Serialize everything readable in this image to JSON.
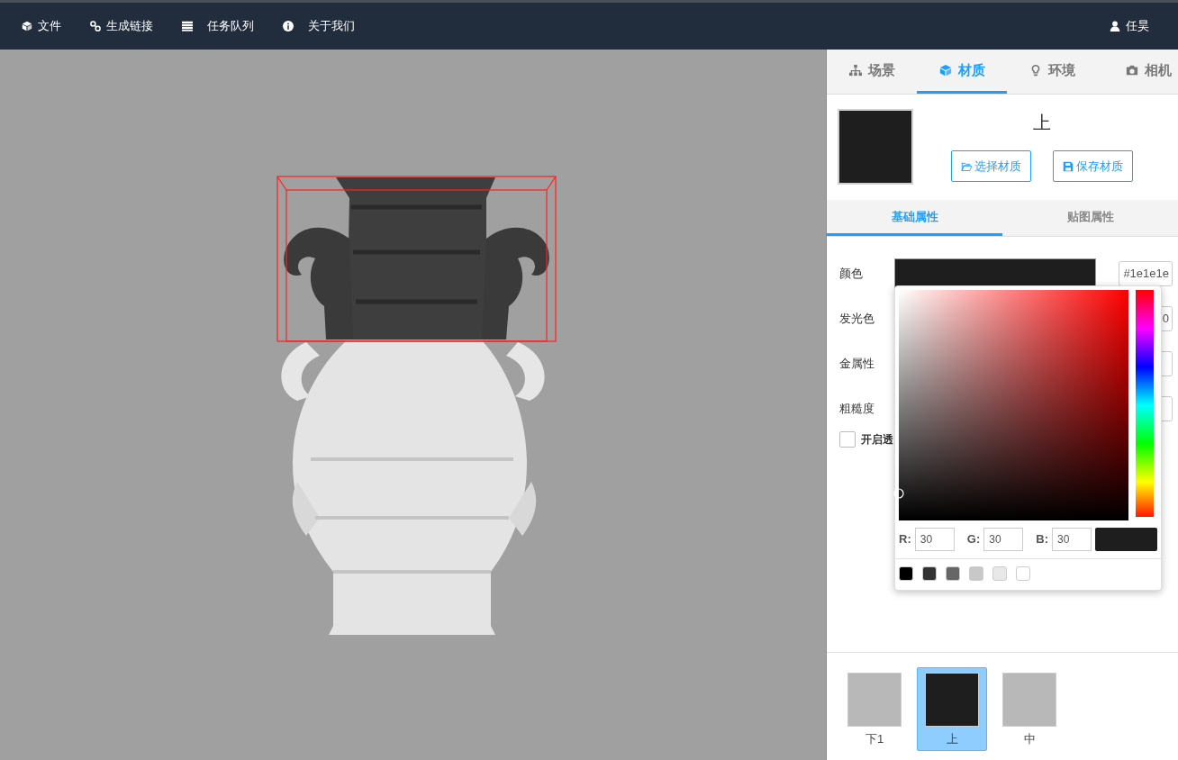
{
  "navbar": {
    "items": [
      {
        "label": "文件"
      },
      {
        "label": "生成链接"
      },
      {
        "label": "任务队列"
      },
      {
        "label": "关于我们"
      }
    ],
    "user": "任昊"
  },
  "panel_tabs": [
    {
      "label": "场景",
      "selected": false
    },
    {
      "label": "材质",
      "selected": true
    },
    {
      "label": "环境",
      "selected": false
    },
    {
      "label": "相机",
      "selected": false
    }
  ],
  "material": {
    "name": "上",
    "color": "#1e1e1e",
    "buttons": [
      "选择材质",
      "保存材质"
    ]
  },
  "sub_tabs": [
    {
      "label": "基础属性",
      "selected": true
    },
    {
      "label": "贴图属性",
      "selected": false
    }
  ],
  "properties": [
    {
      "label": "颜色",
      "kind": "color",
      "color": "#1e1e1e",
      "value": "#1e1e1e"
    },
    {
      "label": "发光色",
      "kind": "text",
      "value": "0"
    },
    {
      "label": "金属性",
      "kind": "text"
    },
    {
      "label": "粗糙度",
      "kind": "text"
    }
  ],
  "transparency": {
    "label": "开启透",
    "checked": false
  },
  "color_picker": {
    "channels": [
      {
        "label": "R:",
        "value": "30"
      },
      {
        "label": "G:",
        "value": "30"
      },
      {
        "label": "B:",
        "value": "30"
      }
    ],
    "hue": {
      "level": 0
    },
    "swatches": [
      {
        "color": "#000000"
      },
      {
        "color": "#333333"
      },
      {
        "color": "#666666"
      },
      {
        "color": "#c8c8c8"
      },
      {
        "color": "#e8e8e8"
      },
      {
        "color": "#ffffff"
      }
    ]
  },
  "materials": [
    {
      "label": "下1",
      "color": "#b8b8b8",
      "selected": false
    },
    {
      "label": "上",
      "color": "#1e1e1e",
      "selected": true
    },
    {
      "label": "中",
      "color": "#b8b8b8",
      "selected": false
    }
  ]
}
